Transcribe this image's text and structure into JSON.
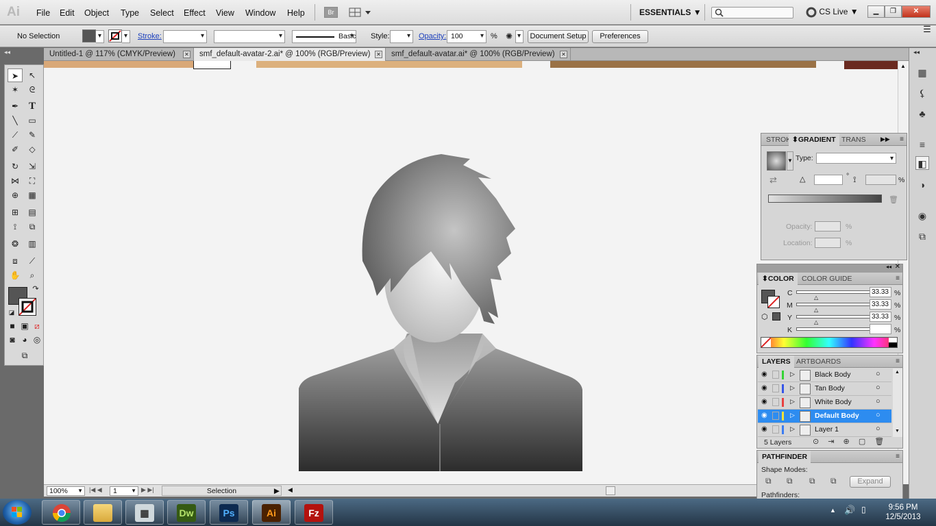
{
  "app": {
    "logo": "Ai"
  },
  "menu": [
    "File",
    "Edit",
    "Object",
    "Type",
    "Select",
    "Effect",
    "View",
    "Window",
    "Help"
  ],
  "menubar": {
    "br_label": "Br",
    "workspace": "ESSENTIALS",
    "cs_live": "CS Live"
  },
  "control": {
    "selection": "No Selection",
    "stroke_label": "Stroke:",
    "brush": "Basic",
    "style_label": "Style:",
    "opacity_label": "Opacity:",
    "opacity_value": "100",
    "pct": "%",
    "document_setup": "Document Setup",
    "preferences": "Preferences"
  },
  "tabs": [
    {
      "label": "Untitled-1 @ 117% (CMYK/Preview)"
    },
    {
      "label": "smf_default-avatar-2.ai* @ 100% (RGB/Preview)"
    },
    {
      "label": "smf_default-avatar.ai* @ 100% (RGB/Preview)"
    }
  ],
  "status": {
    "zoom": "100%",
    "artboard": "1",
    "tool": "Selection"
  },
  "gradient_panel": {
    "tabs": [
      "STROKE",
      "GRADIENT",
      "TRANS"
    ],
    "type_label": "Type:",
    "deg": "°",
    "pct": "%",
    "opacity_label": "Opacity:",
    "location_label": "Location:"
  },
  "color_panel": {
    "tabs": [
      "COLOR",
      "COLOR GUIDE"
    ],
    "channels": [
      {
        "label": "C",
        "value": "33.33"
      },
      {
        "label": "M",
        "value": "33.33"
      },
      {
        "label": "Y",
        "value": "33.33"
      },
      {
        "label": "K",
        "value": ""
      }
    ],
    "pct": "%"
  },
  "layers_panel": {
    "tabs": [
      "LAYERS",
      "ARTBOARDS"
    ],
    "layers": [
      {
        "name": "Black Body",
        "color": "#35d335"
      },
      {
        "name": "Tan Body",
        "color": "#3555e8"
      },
      {
        "name": "White Body",
        "color": "#e84040"
      },
      {
        "name": "Default Body",
        "color": "#f2e23a"
      },
      {
        "name": "Layer 1",
        "color": "#3b7cf2"
      }
    ],
    "count": "5 Layers"
  },
  "pathfinder": {
    "title": "PATHFINDER",
    "shape_modes": "Shape Modes:",
    "expand": "Expand",
    "pathfinders": "Pathfinders:"
  },
  "taskbar": {
    "apps": [
      "Dw",
      "Ps",
      "Ai",
      "Fz"
    ],
    "time": "9:56 PM",
    "date": "12/5/2013"
  },
  "colors": {
    "accent": "#2d8cf0",
    "fill": "#555555"
  }
}
